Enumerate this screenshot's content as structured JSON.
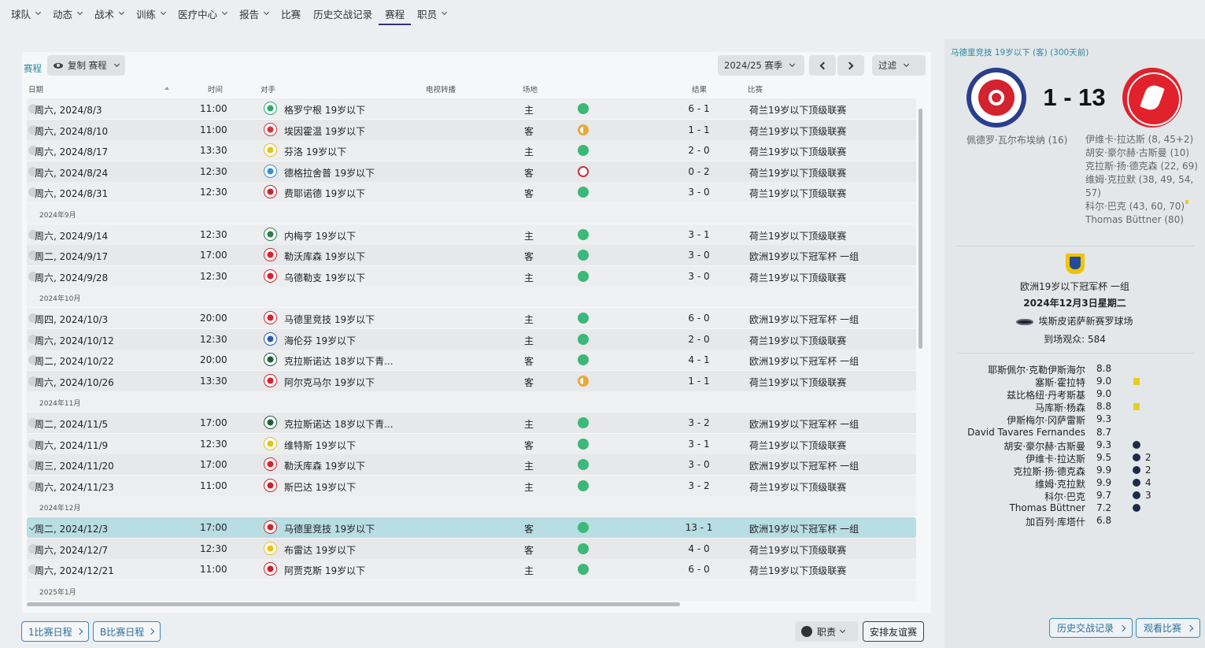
{
  "nav": {
    "items": [
      {
        "label": "球队",
        "dropdown": true
      },
      {
        "label": "动态",
        "dropdown": true
      },
      {
        "label": "战术",
        "dropdown": true
      },
      {
        "label": "训练",
        "dropdown": true
      },
      {
        "label": "医疗中心",
        "dropdown": true
      },
      {
        "label": "报告",
        "dropdown": true
      },
      {
        "label": "比赛",
        "dropdown": false
      },
      {
        "label": "历史交战记录",
        "dropdown": false
      },
      {
        "label": "赛程",
        "dropdown": false,
        "active": true
      },
      {
        "label": "职员",
        "dropdown": true
      }
    ]
  },
  "toolbar": {
    "crumb": "赛程",
    "copy_label": "复制 赛程",
    "season": "2024/25 赛季",
    "filter": "过滤"
  },
  "columns": {
    "date": "日期",
    "time": "时间",
    "opponent": "对手",
    "tv": "电视转播",
    "venue": "场地",
    "result": "结果",
    "competition": "比赛"
  },
  "rows": [
    {
      "type": "fixture",
      "date": "周六, 2024/8/3",
      "time": "11:00",
      "opponent": "格罗宁根 19岁以下",
      "venue": "主",
      "outcome": "win",
      "score": "6 - 1",
      "competition": "荷兰19岁以下顶级联赛",
      "badge_color": "#2fa86a"
    },
    {
      "type": "fixture",
      "date": "周六, 2024/8/10",
      "time": "11:00",
      "opponent": "埃因霍温 19岁以下",
      "venue": "客",
      "outcome": "draw",
      "score": "1 - 1",
      "competition": "荷兰19岁以下顶级联赛",
      "badge_color": "#d6333c"
    },
    {
      "type": "fixture",
      "date": "周六, 2024/8/17",
      "time": "13:30",
      "opponent": "芬洛 19岁以下",
      "venue": "主",
      "outcome": "win",
      "score": "2 - 0",
      "competition": "荷兰19岁以下顶级联赛",
      "badge_color": "#e3c21b"
    },
    {
      "type": "fixture",
      "date": "周六, 2024/8/24",
      "time": "12:30",
      "opponent": "德格拉舍普 19岁以下",
      "venue": "客",
      "outcome": "loss",
      "score": "0 - 2",
      "competition": "荷兰19岁以下顶级联赛",
      "badge_color": "#3d8fd0"
    },
    {
      "type": "fixture",
      "date": "周六, 2024/8/31",
      "time": "12:30",
      "opponent": "费耶诺德 19岁以下",
      "venue": "客",
      "outcome": "win",
      "score": "3 - 0",
      "competition": "荷兰19岁以下顶级联赛",
      "badge_color": "#c8232c"
    },
    {
      "type": "month",
      "label": "2024年9月"
    },
    {
      "type": "fixture",
      "date": "周六, 2024/9/14",
      "time": "12:30",
      "opponent": "内梅亨 19岁以下",
      "venue": "主",
      "outcome": "win",
      "score": "3 - 1",
      "competition": "荷兰19岁以下顶级联赛",
      "badge_color": "#2e7d4a"
    },
    {
      "type": "fixture",
      "date": "周二, 2024/9/17",
      "time": "17:00",
      "opponent": "勒沃库森 19岁以下",
      "venue": "客",
      "outcome": "win",
      "score": "3 - 0",
      "competition": "欧洲19岁以下冠军杯 一组",
      "badge_color": "#d6232c"
    },
    {
      "type": "fixture",
      "date": "周六, 2024/9/28",
      "time": "12:30",
      "opponent": "乌德勒支 19岁以下",
      "venue": "主",
      "outcome": "win",
      "score": "3 - 0",
      "competition": "荷兰19岁以下顶级联赛",
      "badge_color": "#d6232c"
    },
    {
      "type": "month",
      "label": "2024年10月"
    },
    {
      "type": "fixture",
      "date": "周四, 2024/10/3",
      "time": "20:00",
      "opponent": "马德里竞技 19岁以下",
      "venue": "主",
      "outcome": "win",
      "score": "6 - 0",
      "competition": "欧洲19岁以下冠军杯 一组",
      "badge_color": "#d3232e"
    },
    {
      "type": "fixture",
      "date": "周六, 2024/10/12",
      "time": "12:30",
      "opponent": "海伦芬 19岁以下",
      "venue": "主",
      "outcome": "win",
      "score": "2 - 0",
      "competition": "荷兰19岁以下顶级联赛",
      "badge_color": "#2a5db0"
    },
    {
      "type": "fixture",
      "date": "周二, 2024/10/22",
      "time": "20:00",
      "opponent": "克拉斯诺达 18岁以下青...",
      "venue": "客",
      "outcome": "win",
      "score": "4 - 1",
      "competition": "欧洲19岁以下冠军杯 一组",
      "badge_color": "#1f5e3a"
    },
    {
      "type": "fixture",
      "date": "周六, 2024/10/26",
      "time": "13:30",
      "opponent": "阿尔克马尔 19岁以下",
      "venue": "客",
      "outcome": "draw",
      "score": "1 - 1",
      "competition": "荷兰19岁以下顶级联赛",
      "badge_color": "#d6232c"
    },
    {
      "type": "month",
      "label": "2024年11月"
    },
    {
      "type": "fixture",
      "date": "周二, 2024/11/5",
      "time": "17:00",
      "opponent": "克拉斯诺达 18岁以下青...",
      "venue": "主",
      "outcome": "win",
      "score": "3 - 2",
      "competition": "欧洲19岁以下冠军杯 一组",
      "badge_color": "#1f5e3a"
    },
    {
      "type": "fixture",
      "date": "周六, 2024/11/9",
      "time": "12:30",
      "opponent": "维特斯 19岁以下",
      "venue": "客",
      "outcome": "win",
      "score": "3 - 1",
      "competition": "荷兰19岁以下顶级联赛",
      "badge_color": "#e3c21b"
    },
    {
      "type": "fixture",
      "date": "周三, 2024/11/20",
      "time": "17:00",
      "opponent": "勒沃库森 19岁以下",
      "venue": "主",
      "outcome": "win",
      "score": "3 - 0",
      "competition": "欧洲19岁以下冠军杯 一组",
      "badge_color": "#d6232c"
    },
    {
      "type": "fixture",
      "date": "周六, 2024/11/23",
      "time": "11:00",
      "opponent": "斯巴达 19岁以下",
      "venue": "主",
      "outcome": "win",
      "score": "3 - 2",
      "competition": "荷兰19岁以下顶级联赛",
      "badge_color": "#c8232c"
    },
    {
      "type": "month",
      "label": "2024年12月"
    },
    {
      "type": "fixture",
      "date": "周二, 2024/12/3",
      "time": "17:00",
      "opponent": "马德里竞技 19岁以下",
      "venue": "客",
      "outcome": "win",
      "score": "13 - 1",
      "competition": "欧洲19岁以下冠军杯 一组",
      "badge_color": "#d3232e",
      "selected": true
    },
    {
      "type": "fixture",
      "date": "周六, 2024/12/7",
      "time": "12:30",
      "opponent": "布雷达 19岁以下",
      "venue": "客",
      "outcome": "win",
      "score": "4 - 0",
      "competition": "荷兰19岁以下顶级联赛",
      "badge_color": "#f0c01a"
    },
    {
      "type": "fixture",
      "date": "周六, 2024/12/21",
      "time": "11:00",
      "opponent": "阿贾克斯 19岁以下",
      "venue": "主",
      "outcome": "win",
      "score": "6 - 0",
      "competition": "荷兰19岁以下顶级联赛",
      "badge_color": "#c8232c"
    },
    {
      "type": "month",
      "label": "2025年1月"
    }
  ],
  "bottom": {
    "schedule_1": "1比赛日程",
    "schedule_b": "B比赛日程",
    "staff": "职责",
    "friendly": "安排友谊赛"
  },
  "match": {
    "header": "马德里竞技 19岁以下 (客) (300天前)",
    "score": "1 - 13",
    "home_scorer": "佩德罗·瓦尔布埃纳 (16)",
    "away_scorers": [
      {
        "text": "伊维卡·拉达斯 (8, 45+2)",
        "card": false
      },
      {
        "text": "胡安·豪尔赫·古斯曼 (10)",
        "card": false
      },
      {
        "text": "克拉斯·扬·德克森 (22, 69)",
        "card": false
      },
      {
        "text": "维姆·克拉默 (38, 49, 54,",
        "card": false
      },
      {
        "text": "57)",
        "card": false
      },
      {
        "text": "科尔·巴克 (43, 60, 70)",
        "card": true
      },
      {
        "text": "Thomas Büttner (80)",
        "card": false
      }
    ],
    "competition": "欧洲19岁以下冠军杯 一组",
    "date": "2024年12月3日星期二",
    "stadium": "埃斯皮诺萨新赛罗球场",
    "attendance": "到场观众: 584"
  },
  "ratings": [
    {
      "name": "耶斯佩尔·克勒伊斯海尔",
      "rating": "8.8",
      "yellow": false,
      "goals": null
    },
    {
      "name": "塞斯·霍拉特",
      "rating": "9.0",
      "yellow": true,
      "goals": null
    },
    {
      "name": "兹比格纽·丹考斯基",
      "rating": "9.0",
      "yellow": false,
      "goals": null
    },
    {
      "name": "马库斯·杨森",
      "rating": "8.8",
      "yellow": true,
      "goals": null
    },
    {
      "name": "伊斯梅尔·冈萨雷斯",
      "rating": "9.3",
      "yellow": false,
      "goals": null
    },
    {
      "name": "David Tavares Fernandes",
      "rating": "8.7",
      "yellow": false,
      "goals": null
    },
    {
      "name": "胡安·豪尔赫·古斯曼",
      "rating": "9.3",
      "yellow": false,
      "goals": ""
    },
    {
      "name": "伊维卡·拉达斯",
      "rating": "9.5",
      "yellow": false,
      "goals": "2"
    },
    {
      "name": "克拉斯·扬·德克森",
      "rating": "9.9",
      "yellow": false,
      "goals": "2"
    },
    {
      "name": "维姆·克拉默",
      "rating": "9.9",
      "yellow": false,
      "goals": "4"
    },
    {
      "name": "科尔·巴克",
      "rating": "9.7",
      "yellow": false,
      "goals": "3"
    },
    {
      "name": "Thomas Büttner",
      "rating": "7.2",
      "yellow": false,
      "goals": ""
    },
    {
      "name": "加百列·库塔什",
      "rating": "6.8",
      "yellow": false,
      "goals": null
    }
  ],
  "right_buttons": {
    "history": "历史交战记录",
    "watch": "观看比赛"
  }
}
